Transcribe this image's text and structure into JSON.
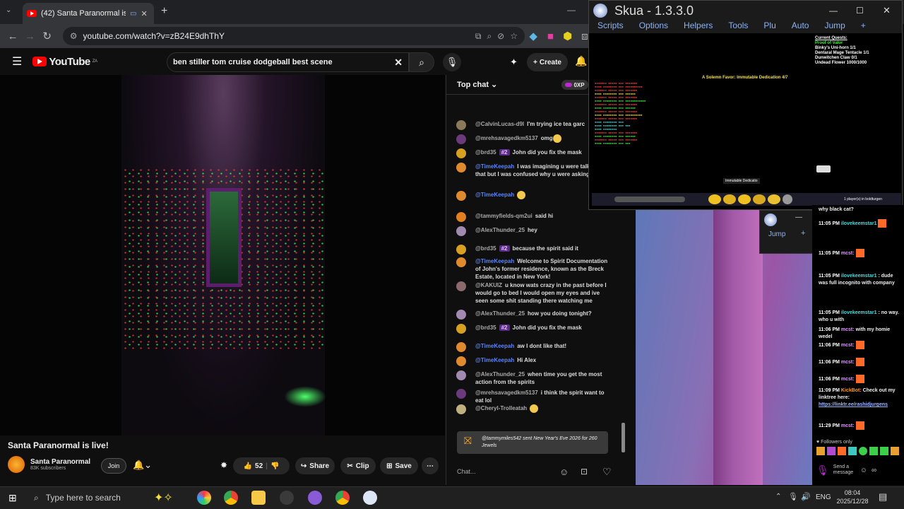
{
  "browser": {
    "tab_title": "(42) Santa Paranormal is live",
    "new_tab_symbol": "+",
    "url": "youtube.com/watch?v=zB24E9dhThY"
  },
  "youtube": {
    "logo_text": "YouTube",
    "region": "ZA",
    "search_value": "ben stiller tom cruise dodgeball best scene",
    "create_label": "Create",
    "notif_count": "9+"
  },
  "video": {
    "title": "Santa Paranormal is live!",
    "channel_name": "Santa Paranormal",
    "subscribers": "83K subscribers",
    "join_label": "Join",
    "like_count": "52",
    "share_label": "Share",
    "clip_label": "Clip",
    "save_label": "Save"
  },
  "chat": {
    "header": "Top chat",
    "xp_badge": "0XP",
    "placeholder": "Chat...",
    "messages": [
      {
        "author": "@CalvinLucas-d9l",
        "text": "I'm trying ice tea garc",
        "color": "#8a7a5a",
        "mod": false
      },
      {
        "author": "@mrehsavagedkm5137",
        "text": "omg",
        "color": "#6b3a7a",
        "mod": false
      },
      {
        "author": "@brd35",
        "text": "John did you fix the mask",
        "color": "#d8a020",
        "mod": false,
        "badge": "#2"
      },
      {
        "author": "@TimeKeepah",
        "text": "I was imagining u were talking abt that but I was confused why u were asking that",
        "color": "#e08a30",
        "mod": true
      },
      {
        "author": "@TimeKeepah",
        "text": "",
        "color": "#e08a30",
        "mod": true
      },
      {
        "author": "@tammyfields-qm2ui",
        "text": "said hi",
        "color": "#e08020",
        "mod": false
      },
      {
        "author": "@AlexThunder_25",
        "text": "hey",
        "color": "#a08ab0",
        "mod": false
      },
      {
        "author": "@brd35",
        "text": "because the spirit said it",
        "color": "#d8a020",
        "mod": false,
        "badge": "#2"
      },
      {
        "author": "@TimeKeepah",
        "text": "Welcome to Spirit Documentation of John's former residence, known as the Breck Estate, located in New York!",
        "color": "#e08a30",
        "mod": true
      },
      {
        "author": "@KAKUIZ",
        "text": "u know wats crazy in the past before I would go to bed I would open my eyes and ive seen some shit standing there watching me",
        "color": "#8a6a6a",
        "mod": false
      },
      {
        "author": "@AlexThunder_25",
        "text": "how you doing tonight?",
        "color": "#a08ab0",
        "mod": false
      },
      {
        "author": "@brd35",
        "text": "John did you fix the mask",
        "color": "#d8a020",
        "mod": false,
        "badge": "#2"
      },
      {
        "author": "@TimeKeepah",
        "text": "aw I dont like that!",
        "color": "#e08a30",
        "mod": true
      },
      {
        "author": "@TimeKeepah",
        "text": "Hi Alex",
        "color": "#e08a30",
        "mod": true
      },
      {
        "author": "@AlexThunder_25",
        "text": "when time you get the most action from the spirits",
        "color": "#a08ab0",
        "mod": false
      },
      {
        "author": "@mrehsavagedkm5137",
        "text": "i think the spirit want to eat lol",
        "color": "#6b3a7a",
        "mod": false
      },
      {
        "author": "@Cheryl-Trolleatah",
        "text": "",
        "color": "#c0b080",
        "mod": false
      }
    ],
    "gift_author": "@tammymiles542",
    "gift_text": "sent New Year's Eve 2026 for 260 Jewels"
  },
  "skua": {
    "title": "Skua - 1.3.3.0",
    "menu": [
      "Scripts",
      "Options",
      "Helpers",
      "Tools",
      "Plu",
      "Auto",
      "Jump",
      "+"
    ],
    "quest_header": "Current Quests:",
    "quest_lines": [
      "Proof of Valor",
      "Binky's Uni-horn 1/1",
      "Dentaral Mage Tentacle 1/1",
      "Dunwitchen Claw 0/1",
      "Undead Flower 1000/1000"
    ],
    "center_text": "A Solemn Favor: Immutable Dedication 4/7",
    "status_right": "1 player(s) in boldturgen",
    "tooltip": "Immutable Dedicatio",
    "mini_label": "Jump"
  },
  "rchat": {
    "messages": [
      {
        "time": "",
        "author": "",
        "text": "why black cat?"
      },
      {
        "time": "11:05 PM",
        "author": "ilovekeemstar1",
        "text": "",
        "style": "n2"
      },
      {
        "time": "11:05 PM",
        "author": "mcst:",
        "text": "",
        "style": "n"
      },
      {
        "time": "11:05 PM",
        "author": "ilovekeemstar1",
        "text": ": dude was full incognito with company",
        "style": "n2"
      },
      {
        "time": "11:05 PM",
        "author": "ilovekeemstar1",
        "text": ": no way. who u with",
        "style": "n2"
      },
      {
        "time": "11:06 PM",
        "author": "mcst:",
        "text": "with my homie wedel",
        "style": "n"
      },
      {
        "time": "11:06 PM",
        "author": "mcst:",
        "text": "",
        "style": "n"
      },
      {
        "time": "11:06 PM",
        "author": "mcst:",
        "text": "",
        "style": "n"
      },
      {
        "time": "11:06 PM",
        "author": "mcst:",
        "text": "",
        "style": "n"
      },
      {
        "time": "11:09 PM",
        "author": "KickBot:",
        "text": "Check out my linktree here:",
        "style": "n3",
        "link": "https://linktr.ee/rashidjurgens"
      },
      {
        "time": "11:29 PM",
        "author": "mcst:",
        "text": "",
        "style": "n"
      }
    ],
    "followers_only": "Followers only",
    "send_label": "Send a message"
  },
  "taskbar": {
    "search_placeholder": "Type here to search",
    "lang": "ENG",
    "time": "08:04",
    "date": "2025/12/28"
  }
}
